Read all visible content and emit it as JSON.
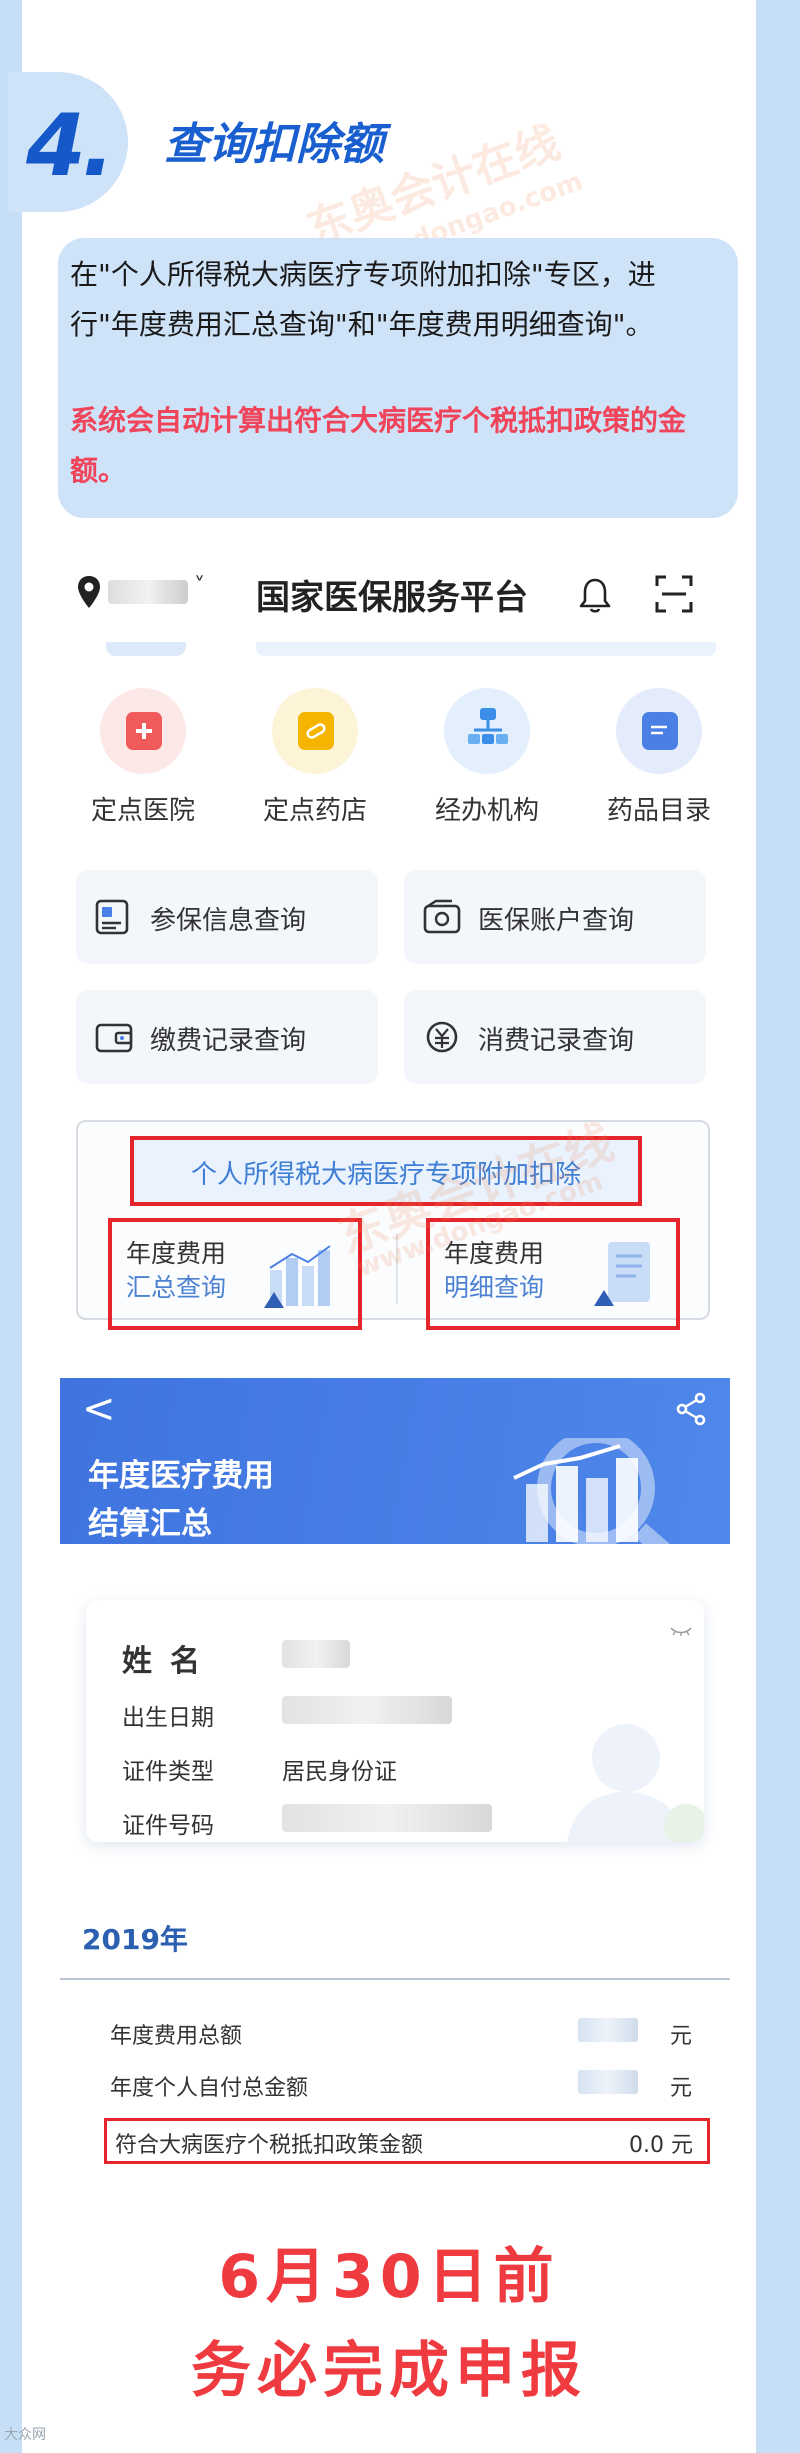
{
  "step": {
    "number": "4.",
    "title": "查询扣除额"
  },
  "intro": {
    "text": "在\"个人所得税大病医疗专项附加扣除\"专区，进行\"年度费用汇总查询\"和\"年度费用明细查询\"。",
    "note": "系统会自动计算出符合大病医疗个税抵扣政策的金额。"
  },
  "watermark": {
    "brand": "东奥会计在线",
    "url": "www.dongao.com"
  },
  "app1": {
    "location_chevron": "˅",
    "title": "国家医保服务平台",
    "quick_links": [
      {
        "label": "定点医院",
        "color": "#f05a5a",
        "bg": "#fde8e8"
      },
      {
        "label": "定点药店",
        "color": "#f4b400",
        "bg": "#fdf3d6"
      },
      {
        "label": "经办机构",
        "color": "#3b8ee8",
        "bg": "#e3effc"
      },
      {
        "label": "药品目录",
        "color": "#4a7fe6",
        "bg": "#e4ecfb"
      }
    ],
    "services": [
      {
        "label": "参保信息查询",
        "icon": "id-card-icon"
      },
      {
        "label": "医保账户查询",
        "icon": "account-icon"
      },
      {
        "label": "缴费记录查询",
        "icon": "wallet-icon"
      },
      {
        "label": "消费记录查询",
        "icon": "yuan-cycle-icon"
      }
    ],
    "tax_section": {
      "title": "个人所得税大病医疗专项附加扣除",
      "summary": {
        "line1": "年度费用",
        "line2": "汇总查询"
      },
      "detail": {
        "line1": "年度费用",
        "line2": "明细查询"
      }
    }
  },
  "app2": {
    "back": "<",
    "title_line1": "年度医疗费用",
    "title_line2": "结算汇总",
    "info": {
      "name_label": "姓名",
      "birth_label": "出生日期",
      "id_type_label": "证件类型",
      "id_type_value": "居民身份证",
      "id_no_label": "证件号码"
    },
    "year": "2019年",
    "rows": [
      {
        "label": "年度费用总额",
        "unit": "元"
      },
      {
        "label": "年度个人自付总金额",
        "unit": "元"
      }
    ],
    "highlight": {
      "label": "符合大病医疗个税抵扣政策金额",
      "value": "0.0 元"
    }
  },
  "deadline": {
    "line1": "6月30日前",
    "line2": "务必完成申报"
  },
  "corner_mark": "大众网"
}
